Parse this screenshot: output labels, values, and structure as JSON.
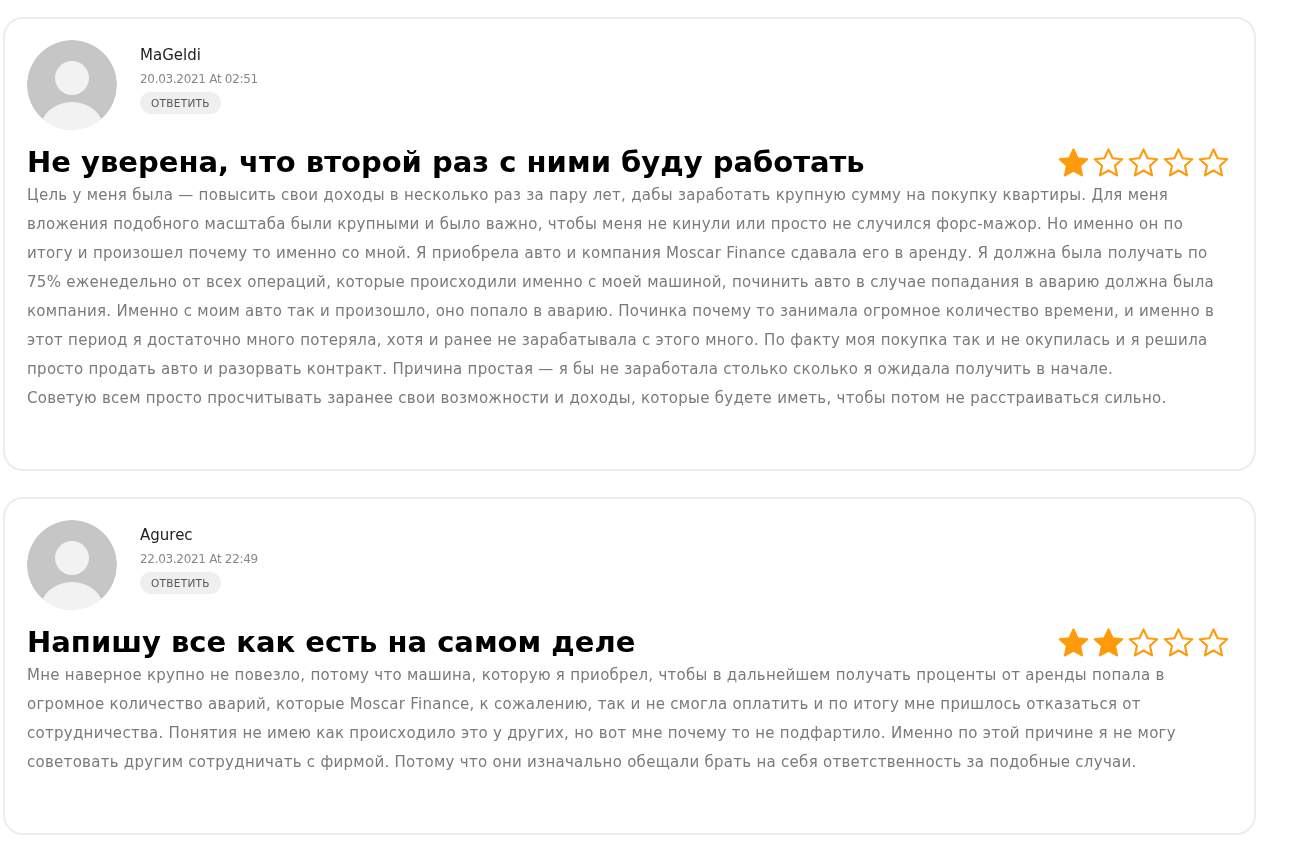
{
  "reviews": [
    {
      "author": "MaGeldi",
      "date": "20.03.2021 At 02:51",
      "reply_button": "ОТВЕТИТЬ",
      "title": "Не уверена, что второй раз с ними буду работать",
      "stars": 1,
      "paragraphs": [
        "Цель у меня была — повысить свои доходы в несколько раз за пару лет, дабы заработать крупную сумму на покупку квартиры. Для меня вложения подобного масштаба были крупными и было важно, чтобы меня не кинули или просто не случился форс-мажор. Но именно он по итогу и произошел почему то именно со мной. Я приобрела авто и компания Moscar Finance сдавала его в аренду. Я должна была получать по 75% еженедельно от всех операций, которые происходили именно с моей машиной, починить авто в случае попадания в аварию должна была компания. Именно с моим авто так и произошло, оно попало в аварию. Починка почему то занимала огромное количество времени, и именно в этот период я достаточно много потеряла, хотя и ранее не зарабатывала с этого много. По факту моя покупка так и не окупилась и я решила просто продать авто и разорвать контракт. Причина простая — я бы не заработала столько сколько я ожидала получить в начале.",
        "Советую всем просто просчитывать заранее свои возможности и доходы, которые будете иметь, чтобы потом не расстраиваться сильно."
      ]
    },
    {
      "author": "Agurec",
      "date": "22.03.2021 At 22:49",
      "reply_button": "ОТВЕТИТЬ",
      "title": "Напишу все как есть на самом деле",
      "stars": 2,
      "paragraphs": [
        "Мне наверное крупно не повезло, потому что машина, которую я приобрел, чтобы в дальнейшем получать проценты от аренды попала в огромное количество аварий, которые Moscar Finance, к сожалению, так и не смогла оплатить и по итогу мне пришлось отказаться от сотрудничества. Понятия не имею как происходило это у других, но вот мне почему то не подфартило. Именно по этой причине я не могу советовать другим сотрудничать с фирмой. Потому что они изначально обещали брать на себя ответственность за подобные случаи."
      ]
    }
  ]
}
